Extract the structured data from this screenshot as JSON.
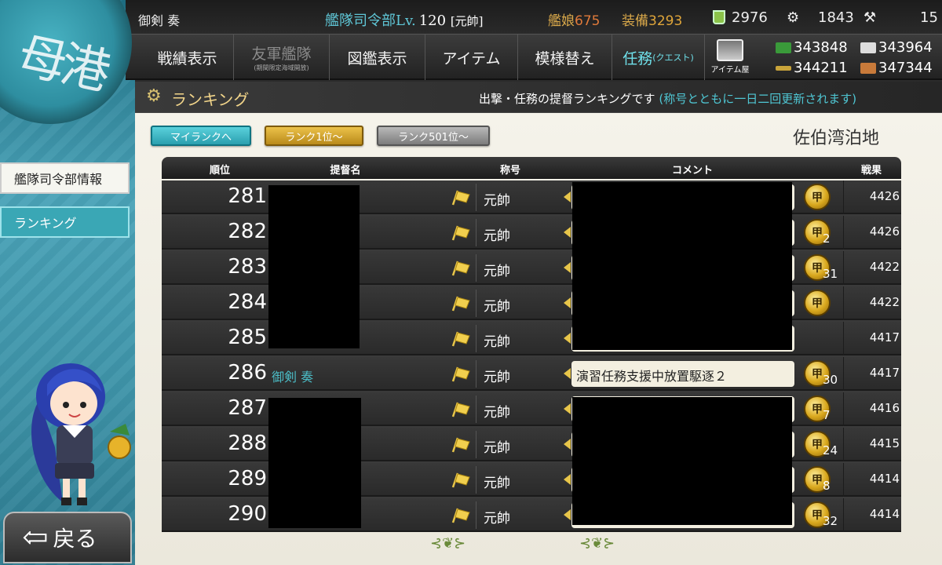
{
  "header": {
    "player_name": "御剣 奏",
    "hq_label": "艦隊司令部Lv.",
    "hq_level": "120",
    "rank_title": "[元帥]",
    "shipgirl_label": "艦娘",
    "shipgirl_count": "675",
    "equip_label": "装備",
    "equip_count": "3293",
    "buckets": "2976",
    "dev_screws": "1843",
    "hammers": "15"
  },
  "nav": {
    "items": [
      {
        "label": "戦績表示",
        "sub": ""
      },
      {
        "label": "友軍艦隊",
        "sub": "(期間限定海域開放)"
      },
      {
        "label": "図鑑表示",
        "sub": ""
      },
      {
        "label": "アイテム",
        "sub": ""
      },
      {
        "label": "模様替え",
        "sub": ""
      },
      {
        "label": "任務",
        "sub": "(クエスト)"
      }
    ],
    "shop_label": "アイテム屋"
  },
  "materials": {
    "fuel": "343848",
    "steel": "343964",
    "ammo": "344211",
    "bauxite": "347344"
  },
  "emblem_text": "母港",
  "sidebar": {
    "hq_info": "艦隊司令部情報",
    "ranking": "ランキング",
    "back": "戻る"
  },
  "titlebar": {
    "title": "ランキング",
    "subtitle": "出撃・任務の提督ランキングです",
    "note": "(称号とともに一日二回更新されます)"
  },
  "tabs": {
    "my_rank": "マイランクへ",
    "top": "ランク1位～",
    "rank501": "ランク501位～"
  },
  "region": "佐伯湾泊地",
  "table": {
    "headers": {
      "rank": "順位",
      "name": "提督名",
      "title": "称号",
      "comment": "コメント",
      "score": "戦果"
    },
    "rows": [
      {
        "rank": "281",
        "name": "",
        "title": "元帥",
        "comment": "",
        "medal": "甲",
        "medal_count": "",
        "score": "4426"
      },
      {
        "rank": "282",
        "name": "",
        "title": "元帥",
        "comment": "",
        "medal": "甲",
        "medal_count": "2",
        "score": "4426"
      },
      {
        "rank": "283",
        "name": "",
        "title": "元帥",
        "comment": "",
        "medal": "甲",
        "medal_count": "31",
        "score": "4422"
      },
      {
        "rank": "284",
        "name": "",
        "title": "元帥",
        "comment": "",
        "medal": "甲",
        "medal_count": "",
        "score": "4422"
      },
      {
        "rank": "285",
        "name": "",
        "title": "元帥",
        "comment": "",
        "medal": "",
        "medal_count": "",
        "score": "4417"
      },
      {
        "rank": "286",
        "name": "御剣 奏",
        "title": "元帥",
        "comment": "演習任務支援中放置駆逐２",
        "medal": "甲",
        "medal_count": "30",
        "score": "4417"
      },
      {
        "rank": "287",
        "name": "",
        "title": "元帥",
        "comment": "",
        "medal": "甲",
        "medal_count": "7",
        "score": "4416"
      },
      {
        "rank": "288",
        "name": "",
        "title": "元帥",
        "comment": "",
        "medal": "甲",
        "medal_count": "24",
        "score": "4415"
      },
      {
        "rank": "289",
        "name": "",
        "title": "元帥",
        "comment": "",
        "medal": "甲",
        "medal_count": "8",
        "score": "4414"
      },
      {
        "rank": "290",
        "name": "",
        "title": "元帥",
        "comment": "",
        "medal": "甲",
        "medal_count": "32",
        "score": "4414"
      }
    ]
  },
  "colors": {
    "accent": "#4bbcc6",
    "gold": "#d9a81e"
  }
}
